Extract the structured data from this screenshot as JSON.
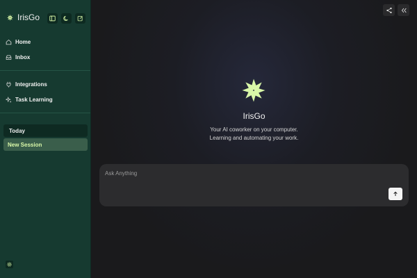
{
  "app": {
    "name": "IrisGo"
  },
  "sidebar": {
    "tools": [
      "toggle-sidebar-icon",
      "moon-icon",
      "edit-icon"
    ],
    "nav_primary": [
      {
        "label": "Home",
        "icon": "home-icon"
      },
      {
        "label": "Inbox",
        "icon": "inbox-icon"
      }
    ],
    "nav_secondary": [
      {
        "label": "Integrations",
        "icon": "plug-icon"
      },
      {
        "label": "Task Learning",
        "icon": "sparkles-icon"
      }
    ],
    "sections": [
      {
        "label": "Today",
        "sessions": [
          "New Session"
        ]
      }
    ]
  },
  "main": {
    "title": "IrisGo",
    "subtitle_line1": "Your AI coworker on your computer.",
    "subtitle_line2": "Learning and automating your work.",
    "input_placeholder": "Ask Anything"
  },
  "colors": {
    "sidebar_bg": "#163a30",
    "accent": "#d9f7a8",
    "main_bg": "#1a1a1c"
  }
}
